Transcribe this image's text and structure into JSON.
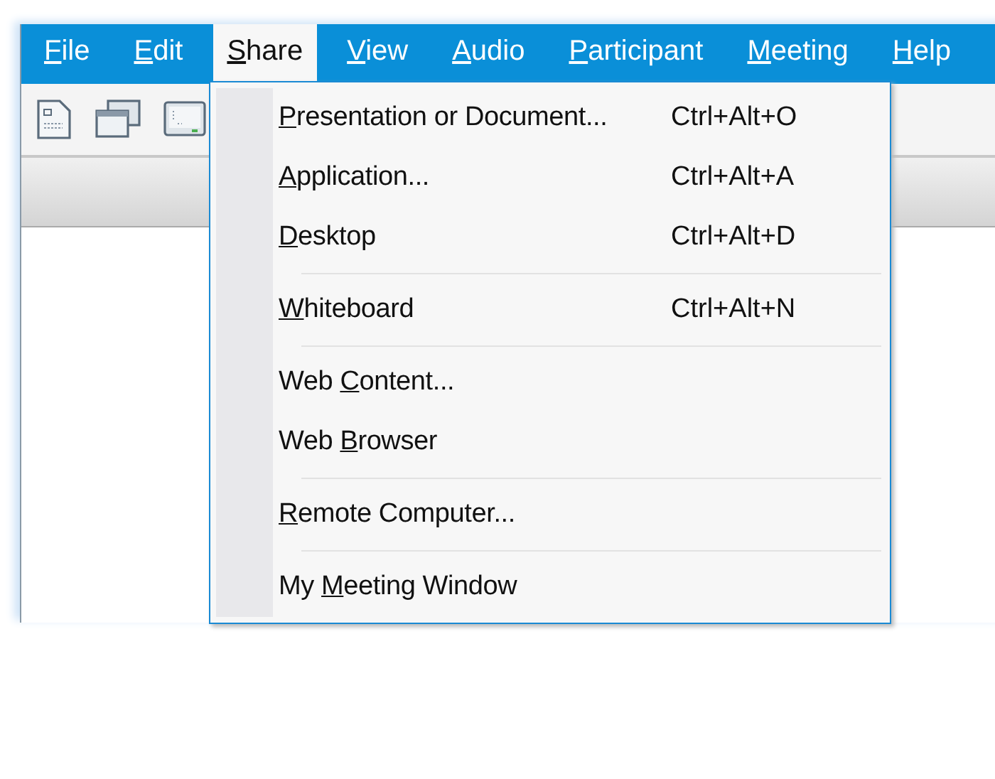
{
  "menu_bar": [
    {
      "key": "F",
      "after": "ile",
      "selected": false
    },
    {
      "key": "E",
      "after": "dit",
      "selected": false
    },
    {
      "key": "S",
      "after": "hare",
      "selected": true
    },
    {
      "key": "V",
      "after": "iew",
      "selected": false
    },
    {
      "key": "A",
      "after": "udio",
      "selected": false
    },
    {
      "key": "P",
      "after": "articipant",
      "selected": false
    },
    {
      "key": "M",
      "after": "eeting",
      "selected": false
    },
    {
      "key": "H",
      "after": "elp",
      "selected": false
    }
  ],
  "toolbar": [
    {
      "kind": "document"
    },
    {
      "kind": "windows"
    },
    {
      "kind": "monitor"
    }
  ],
  "share_menu": [
    {
      "kind": "item",
      "key": "P",
      "after": "resentation or Document...",
      "shortcut": "Ctrl+Alt+O"
    },
    {
      "kind": "item",
      "key": "A",
      "after": "pplication...",
      "shortcut": "Ctrl+Alt+A"
    },
    {
      "kind": "item",
      "key": "D",
      "after": "esktop",
      "shortcut": "Ctrl+Alt+D"
    },
    {
      "kind": "separator"
    },
    {
      "kind": "item",
      "key": "W",
      "after": "hiteboard",
      "shortcut": "Ctrl+Alt+N"
    },
    {
      "kind": "separator"
    },
    {
      "kind": "item",
      "before": "Web ",
      "key": "C",
      "after": "ontent..."
    },
    {
      "kind": "item",
      "before": "Web ",
      "key": "B",
      "after": "rowser"
    },
    {
      "kind": "separator"
    },
    {
      "kind": "item",
      "key": "R",
      "after": "emote Computer..."
    },
    {
      "kind": "separator"
    },
    {
      "kind": "item",
      "before": "My ",
      "key": "M",
      "after": "eeting Window"
    }
  ]
}
